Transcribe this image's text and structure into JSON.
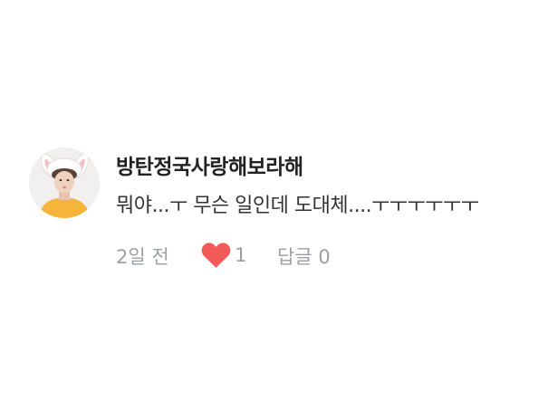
{
  "comment": {
    "username": "방탄정국사랑해보라해",
    "text": "뭐야...ㅜ 무슨 일인데 도대체....ㅜㅜㅜㅜㅜㅜ",
    "time": "2일 전",
    "like_count": "1",
    "reply_label": "답글 0",
    "colors": {
      "heart": "#f25a5a",
      "meta": "#9aa0a6",
      "username": "#222222"
    },
    "icons": [
      "avatar",
      "heart-icon"
    ]
  }
}
